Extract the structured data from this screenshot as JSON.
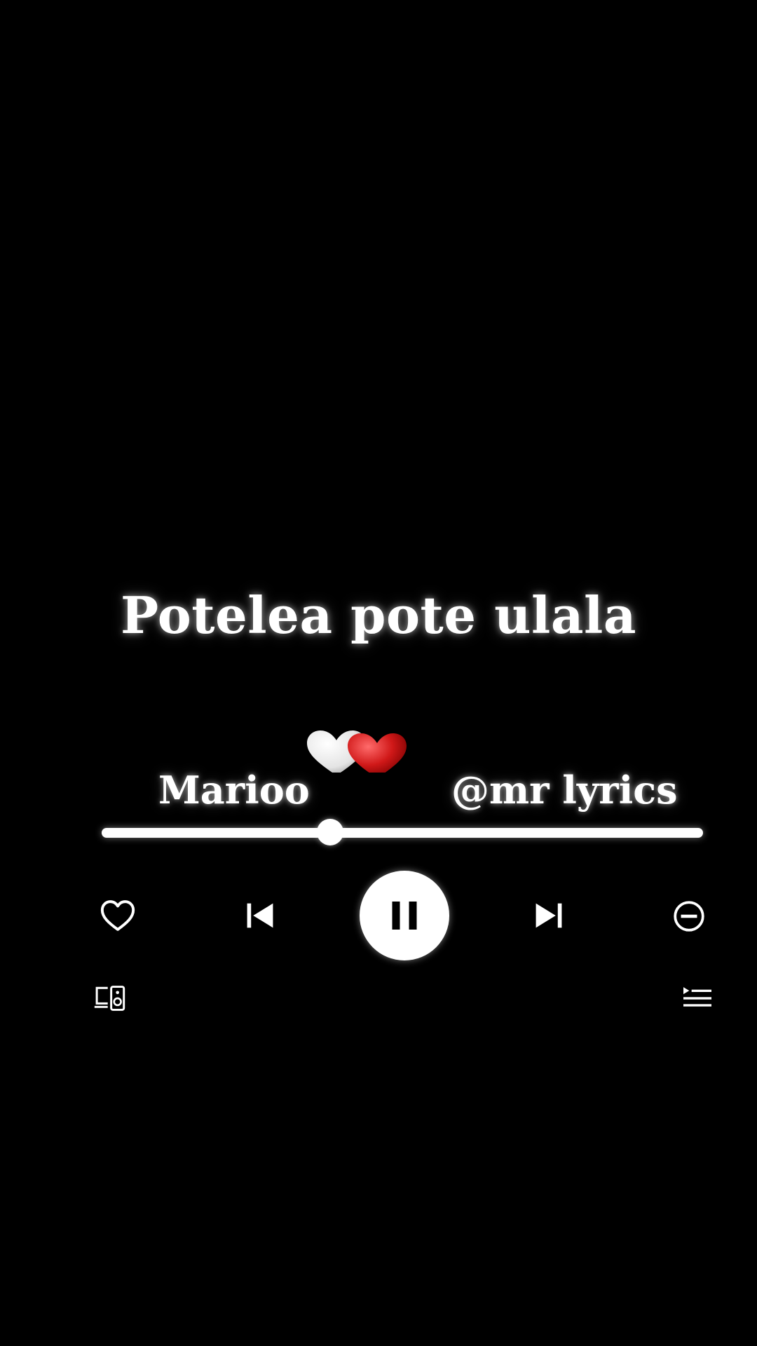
{
  "lyric": {
    "line": "Potelea pote ulala"
  },
  "track": {
    "artist": "Marioo",
    "watermark_handle": "@mr lyrics",
    "progress_fraction": 0.38
  },
  "controls": {
    "like": "heart-outline-icon",
    "previous": "skip-previous-icon",
    "play_pause": "pause-icon",
    "next": "skip-next-icon",
    "hide": "minus-circle-icon",
    "devices": "devices-icon",
    "queue": "queue-icon"
  },
  "decor": {
    "hearts": [
      "white-heart",
      "red-heart"
    ]
  },
  "colors": {
    "background": "#000000",
    "foreground": "#ffffff",
    "heart_red": "#c8102e"
  }
}
